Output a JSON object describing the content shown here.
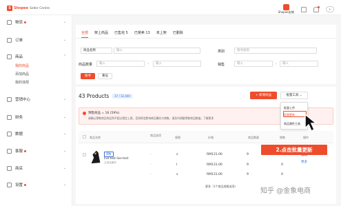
{
  "topbar": {
    "logo_mark": "S",
    "logo_text": "Shopee",
    "logo_sub": "Seller Centre",
    "shop_label": "Shopee店铺",
    "user": "•"
  },
  "sidebar": {
    "items": [
      {
        "label": "物流",
        "dot": true,
        "icon": "truck-icon"
      },
      {
        "label": "订单",
        "dot": false,
        "icon": "order-icon"
      },
      {
        "label": "商品",
        "dot": false,
        "icon": "product-icon"
      },
      {
        "label": "营销中心",
        "dot": false,
        "icon": "marketing-icon"
      },
      {
        "label": "财务",
        "dot": false,
        "icon": "wallet-icon"
      },
      {
        "label": "数据",
        "dot": false,
        "icon": "chart-icon"
      },
      {
        "label": "客服",
        "dot": true,
        "icon": "headset-icon"
      },
      {
        "label": "商店",
        "dot": false,
        "icon": "shop-icon"
      },
      {
        "label": "设置",
        "dot": true,
        "icon": "gear-icon"
      }
    ],
    "sub_items": [
      "我的商品",
      "添加商品",
      "我的违规"
    ]
  },
  "tabs": [
    "全部",
    "架上商品",
    "已售完 5",
    "已禁卖 13",
    "未上架",
    "已删除"
  ],
  "filters": {
    "name_select": "商品名称",
    "name_placeholder": "输入",
    "category_label": "类别",
    "category_placeholder": "搜寻类别",
    "stock_label": "商品数量",
    "stock_min": "输入",
    "stock_max": "输入",
    "sales_label": "销售",
    "sales_min": "输入",
    "sales_max": "输入",
    "dash": "–",
    "search_btn": "搜寻",
    "reset_btn": "重设"
  },
  "products": {
    "count_title": "43 Products",
    "quota": "37 / 32,000",
    "add_btn": "+ 新增商品",
    "bulk_btn": "批量工具",
    "bulk_chevron": "⌄"
  },
  "dropdown": {
    "items": [
      "批量上传",
      "批量更新",
      "商品属性工具"
    ]
  },
  "warning": {
    "title": "预售商品 = 16 (59%)",
    "body": "请确认预售商品的比例不超过规定上限，否则将会影响商品曝光与销售，请及时调整预售商品数量。了解更多"
  },
  "table": {
    "headers": [
      "商品名称",
      "商品选项",
      "规格",
      "价格",
      "商品数量",
      "销售",
      "操作"
    ],
    "product": {
      "tag": "预售",
      "name": "live-test-live-test",
      "sub": "主商品编号"
    },
    "rows": [
      {
        "variant": "s",
        "price": "RM131.00",
        "stock": "9",
        "sales": "0"
      },
      {
        "variant": "l",
        "price": "RM131.00",
        "stock": "9",
        "sales": "0"
      },
      {
        "variant": "s",
        "price": "RM131.00",
        "stock": "9",
        "sales": "0"
      }
    ],
    "actions": [
      "编辑",
      "更多"
    ],
    "more_link": "更多（1个商品规格选项）"
  },
  "callout": "2.点击批量更新",
  "watermark": "知乎 @金象电商",
  "colors": {
    "accent": "#ee4d2d",
    "link": "#3b6fd8"
  }
}
